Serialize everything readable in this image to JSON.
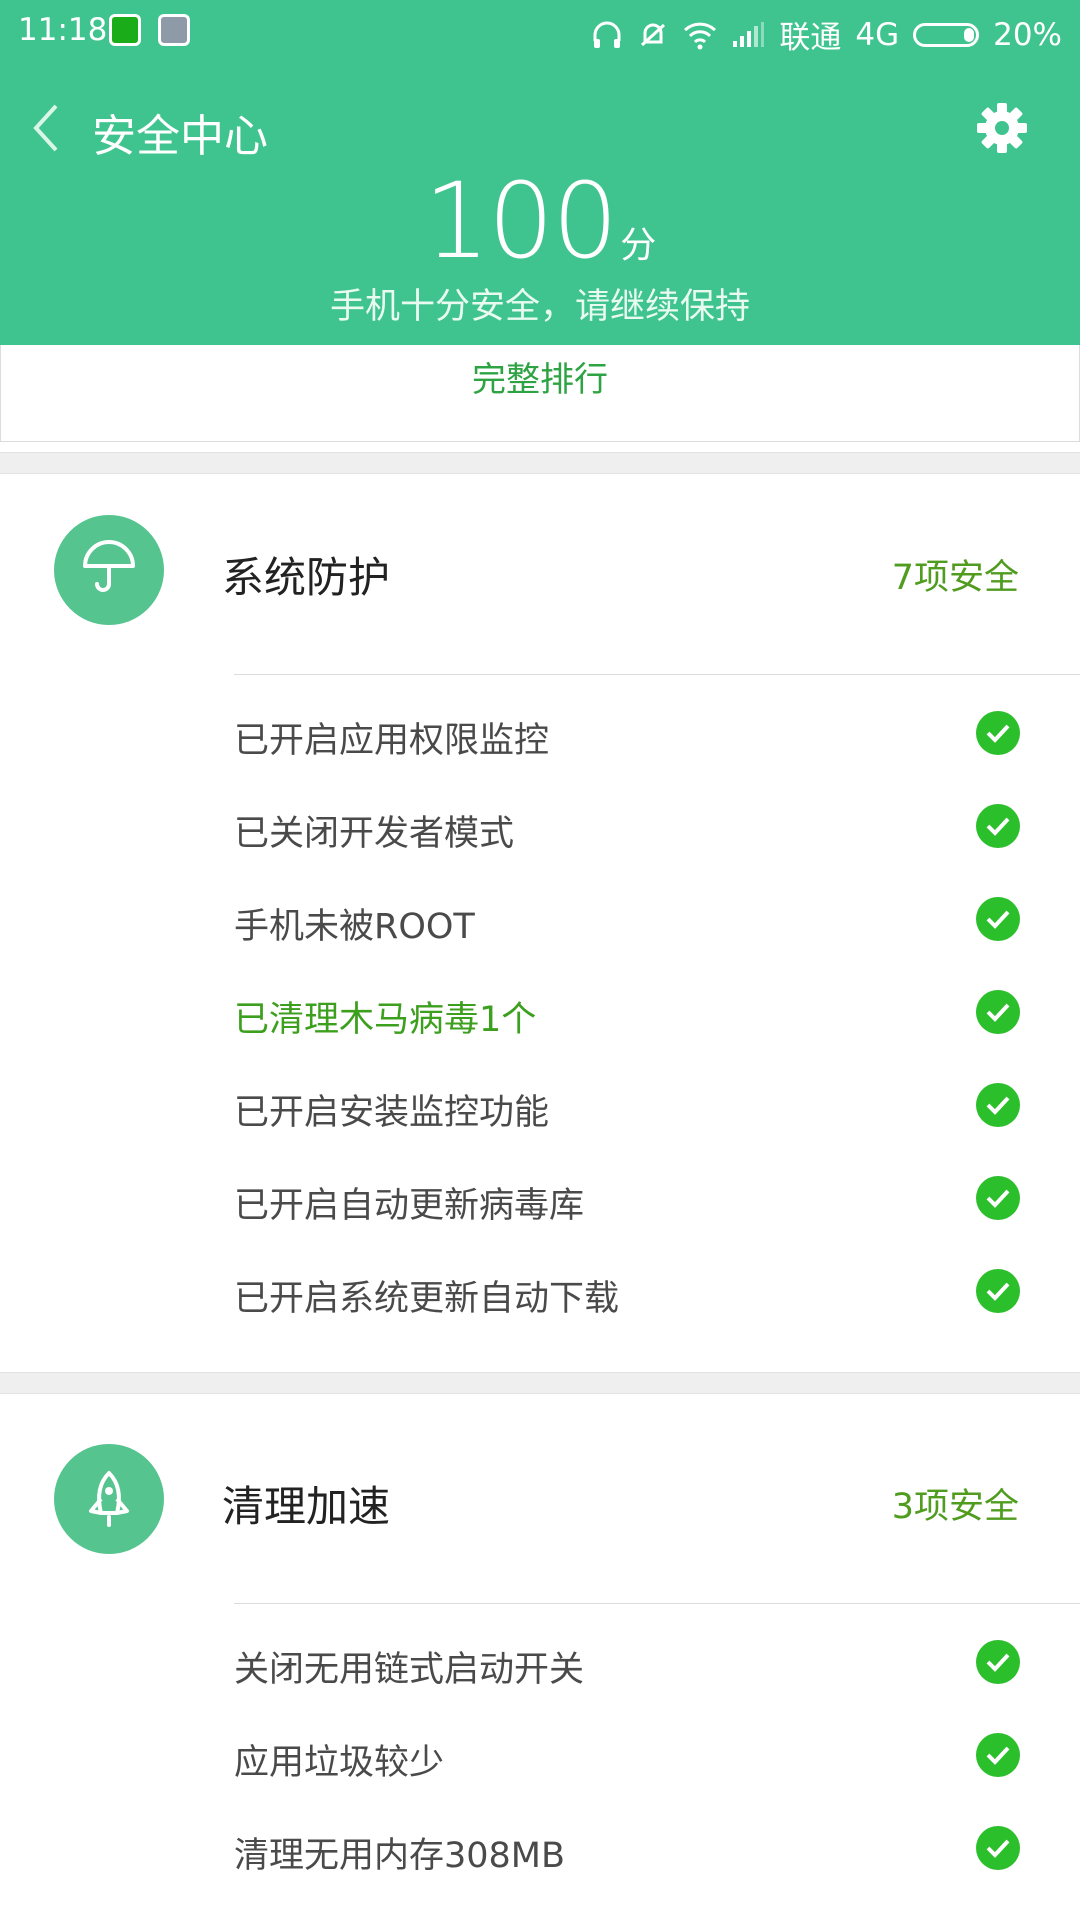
{
  "status_bar": {
    "time": "11:18",
    "carrier": "联通",
    "network": "4G",
    "battery": "20%"
  },
  "header": {
    "title": "安全中心",
    "score": "100",
    "score_unit": "分",
    "subtitle": "手机十分安全，请继续保持"
  },
  "rank_link": "完整排行",
  "sections": [
    {
      "icon": "umbrella-icon",
      "title": "系统防护",
      "count": "7项安全",
      "items": [
        "已开启应用权限监控",
        "已关闭开发者模式",
        "手机未被ROOT",
        "已清理木马病毒1个",
        "已开启安装监控功能",
        "已开启自动更新病毒库",
        "已开启系统更新自动下载"
      ]
    },
    {
      "icon": "rocket-icon",
      "title": "清理加速",
      "count": "3项安全",
      "items": [
        "关闭无用链式启动开关",
        "应用垃圾较少",
        "清理无用内存308MB"
      ]
    }
  ],
  "colors": {
    "header_bg": "#40c48f",
    "check_green": "#2bbf2b",
    "count_text": "#4f9c1e",
    "rank_text": "#2ea343"
  }
}
